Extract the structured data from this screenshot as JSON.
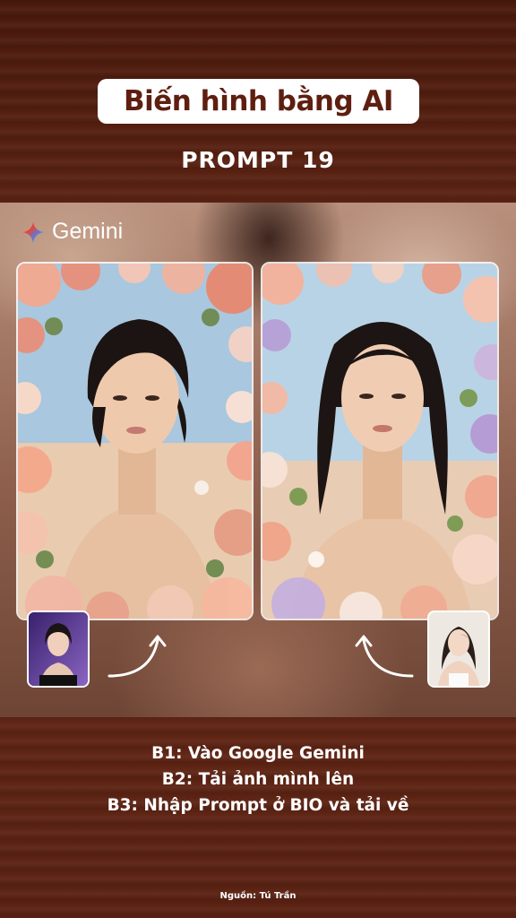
{
  "header": {
    "title": "Biến hình bằng AI",
    "prompt_label": "PROMPT 19"
  },
  "brand": {
    "name": "Gemini",
    "icon": "gemini-star-icon"
  },
  "images": {
    "left_result": "portrait-short-hair-flowers",
    "right_result": "portrait-long-hair-flowers",
    "left_original": "original-photo-thumbnail",
    "right_original": "original-photo-thumbnail"
  },
  "steps": [
    "B1: Vào Google Gemini",
    "B2: Tải ảnh mình lên",
    "B3: Nhập Prompt ở BIO và tải về"
  ],
  "footer": {
    "source": "Nguồn: Tú Trần"
  },
  "colors": {
    "background": "#5a2213",
    "title_text": "#5e1f10",
    "title_bg": "#ffffff"
  }
}
